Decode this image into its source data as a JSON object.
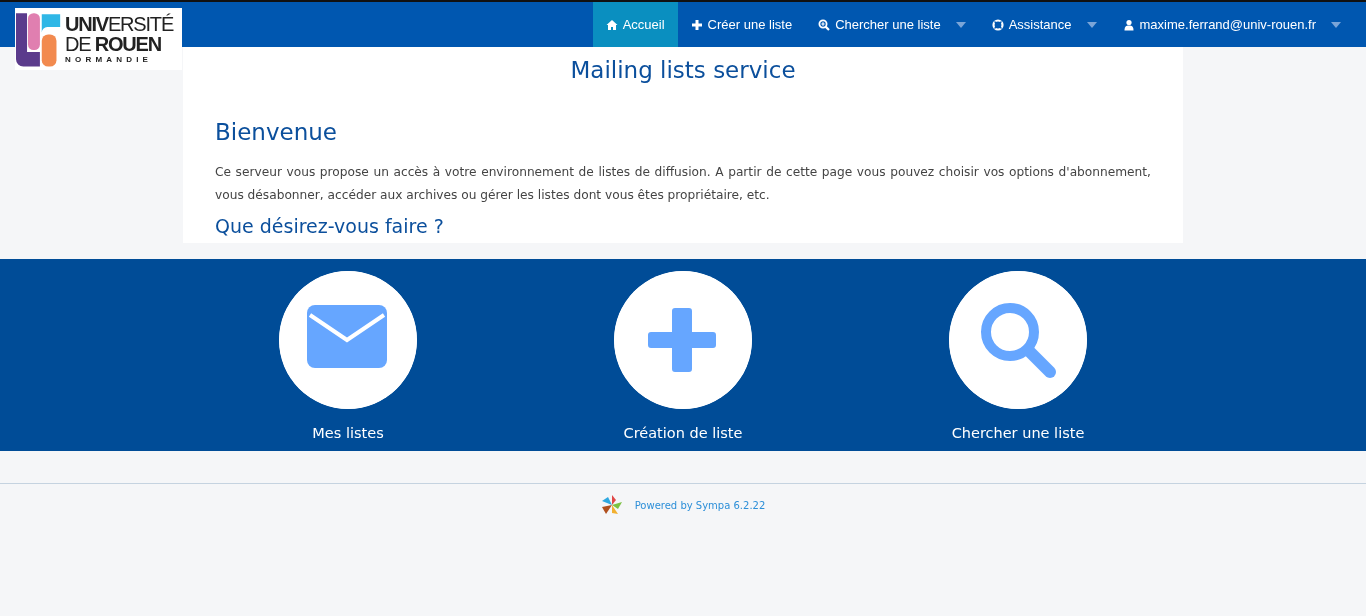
{
  "logo": {
    "lines": [
      "**UNIV**ERSITÉ",
      "DE **ROUEN**"
    ],
    "subtitle": "NORMANDIE"
  },
  "nav": [
    {
      "label": "Accueil",
      "kind": "home",
      "dropdown": false,
      "selected": true
    },
    {
      "label": "Créer une liste",
      "kind": "create",
      "dropdown": false,
      "selected": false
    },
    {
      "label": "Chercher une liste",
      "kind": "search",
      "dropdown": true,
      "selected": false
    },
    {
      "label": "Assistance",
      "kind": "help",
      "dropdown": true,
      "selected": false
    },
    {
      "label": "maxime.ferrand@univ-rouen.fr",
      "kind": "account",
      "dropdown": true,
      "selected": false
    }
  ],
  "page_title": "Mailing lists service",
  "heading": "Bienvenue",
  "intro": "Ce serveur vous propose un accès à votre environnement de listes de diffusion. A partir de cette page vous pouvez choisir vos options d'abonnement, vous désabonner, accéder aux archives ou gérer les listes dont vous êtes propriétaire, etc.",
  "subheading": "Que désirez-vous faire ?",
  "tiles": [
    {
      "label": "Mes listes",
      "kind": "lists"
    },
    {
      "label": "Création de liste",
      "kind": "create"
    },
    {
      "label": "Chercher une liste",
      "kind": "search"
    }
  ],
  "footer": {
    "text": "Powered by Sympa 6.2.22"
  }
}
